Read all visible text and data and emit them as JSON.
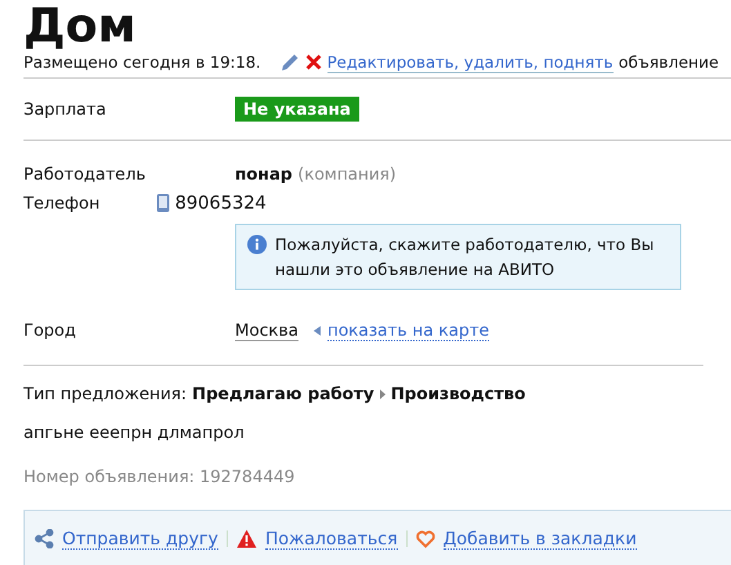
{
  "title": "Дом",
  "posted": {
    "text": "Размещено сегодня в 19:18.",
    "edit_link": "Редактировать, удалить, поднять",
    "suffix": "объявление"
  },
  "salary": {
    "label": "Зарплата",
    "value": "Не указана"
  },
  "employer": {
    "label": "Работодатель",
    "name": "понар",
    "type": "(компания)"
  },
  "phone": {
    "label": "Телефон",
    "number": "89065324"
  },
  "notice": "Пожалуйста, скажите работодателю, что Вы нашли это объявление на АВИТО",
  "city": {
    "label": "Город",
    "value": "Москва",
    "map_link": "показать на карте"
  },
  "offer": {
    "label": "Тип предложения:",
    "category": "Предлагаю работу",
    "subcategory": "Производство"
  },
  "description": "апгьне ееепрн длмапрол",
  "ad_number": "Номер объявления: 192784449",
  "actions": [
    {
      "kind": "share",
      "label": "Отправить другу"
    },
    {
      "kind": "report",
      "label": "Пожаловаться"
    },
    {
      "kind": "bookmark",
      "label": "Добавить в закладки"
    }
  ]
}
